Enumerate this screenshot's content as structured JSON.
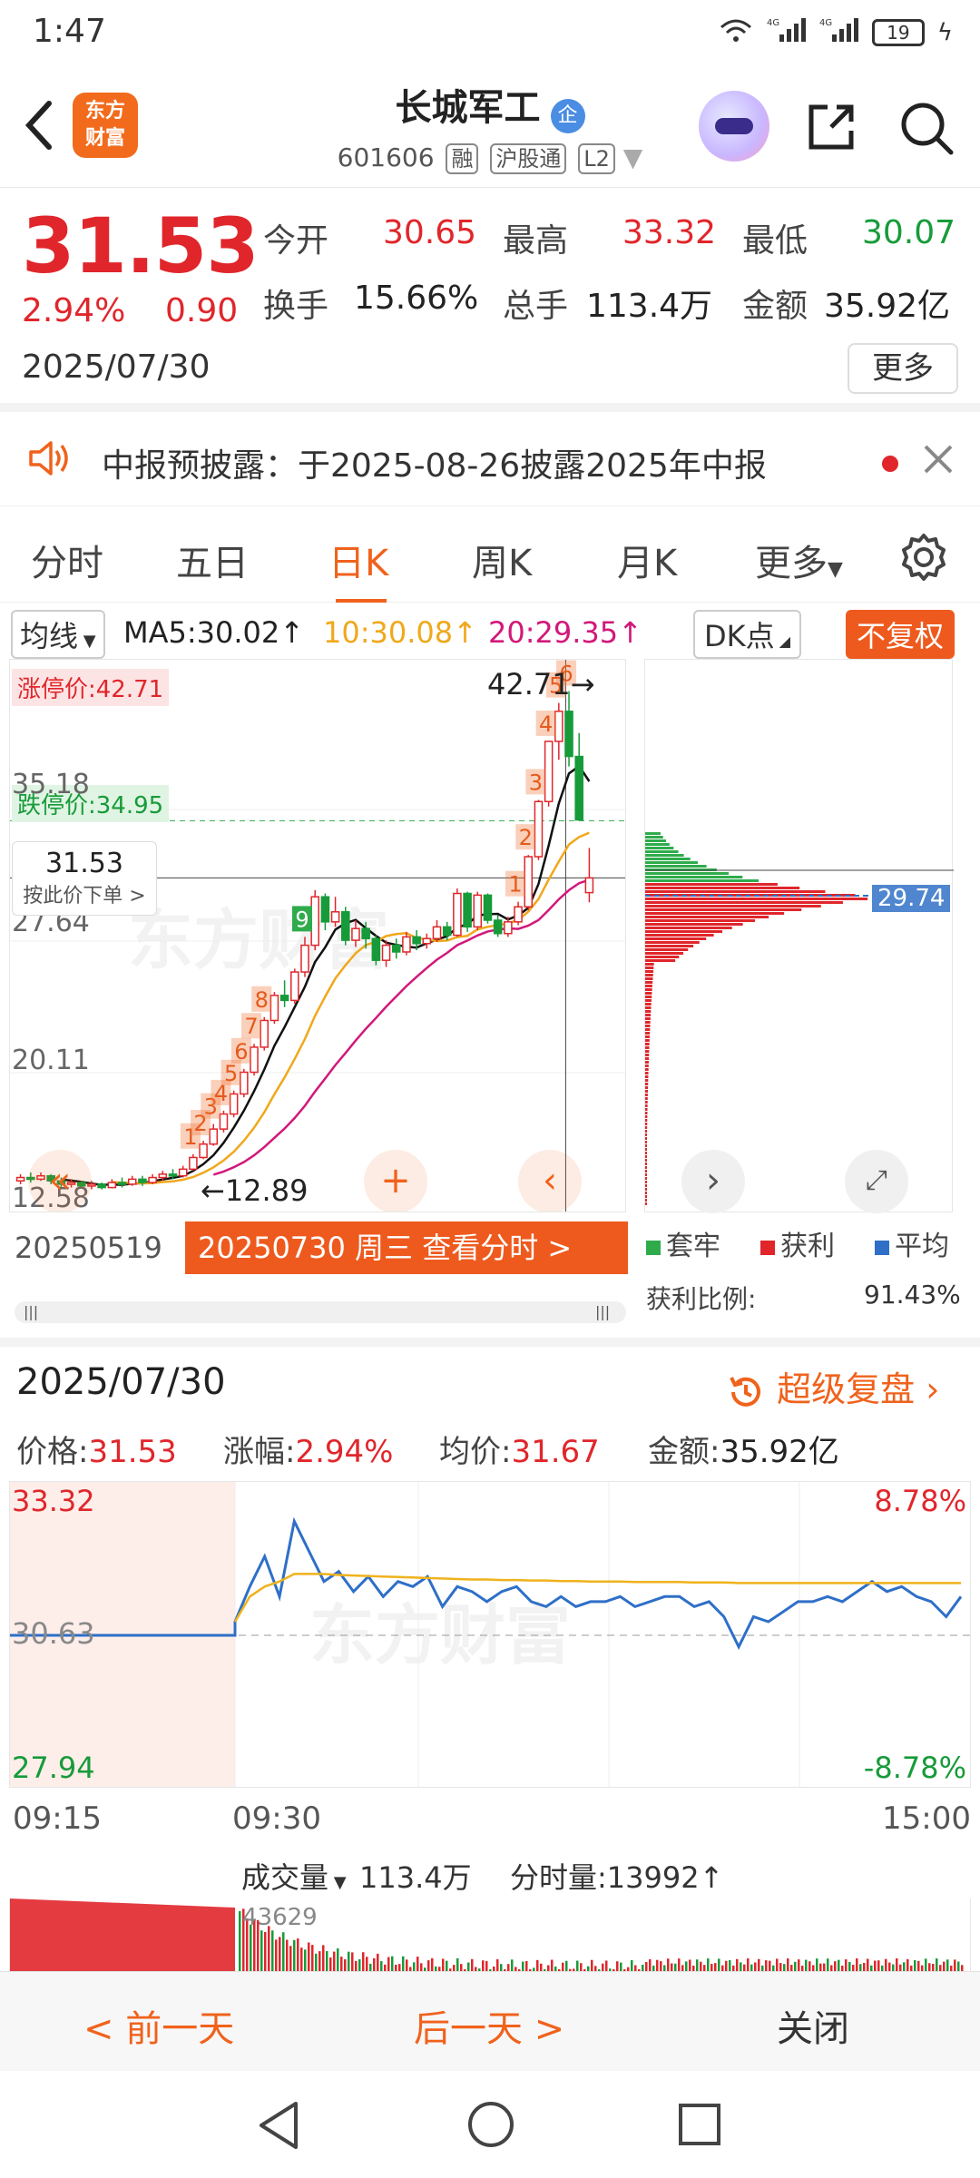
{
  "status": {
    "time": "1:47",
    "battery": "19",
    "net1": "4G",
    "net2": "4G"
  },
  "header": {
    "logo_line1": "东方",
    "logo_line2": "财富",
    "title": "长城军工",
    "title_badge": "企",
    "code": "601606",
    "tags": [
      "融",
      "沪股通",
      "L2"
    ]
  },
  "quote": {
    "price": "31.53",
    "pct": "2.94%",
    "change": "0.90",
    "date": "2025/07/30",
    "open_label": "今开",
    "open": "30.65",
    "high_label": "最高",
    "high": "33.32",
    "low_label": "最低",
    "low": "30.07",
    "turnover_label": "换手",
    "turnover": "15.66%",
    "volume_label": "总手",
    "volume": "113.4万",
    "amount_label": "金额",
    "amount": "35.92亿",
    "more": "更多"
  },
  "notice": {
    "text": "中报预披露：于2025-08-26披露2025年中报"
  },
  "tabs": [
    "分时",
    "五日",
    "日K",
    "周K",
    "月K",
    "更多"
  ],
  "indicator": {
    "ma_select": "均线",
    "ma5": "MA5:30.02↑",
    "ma10": "10:30.08↑",
    "ma20": "20:29.35↑",
    "dk": "DK点",
    "fq": "不复权",
    "ma10_color": "#f0a81c",
    "ma20_color": "#d2187a"
  },
  "kline": {
    "limit_up": "涨停价:42.71",
    "limit_down": "跌停价:34.95",
    "y_labels": [
      "35.18",
      "27.64",
      "20.11",
      "12.58"
    ],
    "high_marker": "42.71",
    "low_marker": "12.89",
    "crosshair_price": "31.53",
    "crosshair_hint": "按此价下单",
    "watermark": "东方财富",
    "counts": [
      "1",
      "2",
      "3",
      "4",
      "5",
      "6",
      "7",
      "8",
      "9",
      "1",
      "2",
      "3",
      "4",
      "5",
      "6"
    ],
    "date_left": "20250519",
    "date_button": "20250730 周三 查看分时 >",
    "candles": [
      {
        "o": 13.4,
        "c": 13.6,
        "h": 13.8,
        "l": 13.2
      },
      {
        "o": 13.6,
        "c": 13.5,
        "h": 13.9,
        "l": 13.3
      },
      {
        "o": 13.5,
        "c": 13.7,
        "h": 13.9,
        "l": 13.4
      },
      {
        "o": 13.7,
        "c": 13.4,
        "h": 13.8,
        "l": 13.2
      },
      {
        "o": 13.4,
        "c": 13.2,
        "h": 13.6,
        "l": 13.0
      },
      {
        "o": 13.2,
        "c": 13.3,
        "h": 13.5,
        "l": 13.0
      },
      {
        "o": 13.3,
        "c": 13.1,
        "h": 13.4,
        "l": 12.95
      },
      {
        "o": 13.1,
        "c": 13.2,
        "h": 13.4,
        "l": 12.9
      },
      {
        "o": 13.2,
        "c": 13.0,
        "h": 13.3,
        "l": 12.89
      },
      {
        "o": 13.0,
        "c": 13.3,
        "h": 13.5,
        "l": 12.95
      },
      {
        "o": 13.3,
        "c": 13.2,
        "h": 13.6,
        "l": 13.0
      },
      {
        "o": 13.2,
        "c": 13.5,
        "h": 13.7,
        "l": 13.1
      },
      {
        "o": 13.5,
        "c": 13.3,
        "h": 13.7,
        "l": 13.1
      },
      {
        "o": 13.3,
        "c": 13.6,
        "h": 13.8,
        "l": 13.2
      },
      {
        "o": 13.6,
        "c": 13.8,
        "h": 14.0,
        "l": 13.4
      },
      {
        "o": 13.8,
        "c": 13.7,
        "h": 14.1,
        "l": 13.5
      },
      {
        "o": 13.7,
        "c": 14.1,
        "h": 14.3,
        "l": 13.6
      },
      {
        "o": 14.1,
        "c": 14.8,
        "h": 15.0,
        "l": 14.0
      },
      {
        "o": 14.8,
        "c": 15.6,
        "h": 15.8,
        "l": 14.7
      },
      {
        "o": 15.6,
        "c": 16.5,
        "h": 16.8,
        "l": 15.5
      },
      {
        "o": 16.5,
        "c": 17.4,
        "h": 17.6,
        "l": 16.3
      },
      {
        "o": 17.4,
        "c": 18.6,
        "h": 18.8,
        "l": 17.2
      },
      {
        "o": 18.6,
        "c": 19.9,
        "h": 20.1,
        "l": 18.4
      },
      {
        "o": 19.9,
        "c": 21.4,
        "h": 21.6,
        "l": 19.7
      },
      {
        "o": 21.4,
        "c": 23.0,
        "h": 23.2,
        "l": 21.2
      },
      {
        "o": 23.0,
        "c": 24.5,
        "h": 24.7,
        "l": 22.8
      },
      {
        "o": 24.5,
        "c": 24.2,
        "h": 25.4,
        "l": 23.8
      },
      {
        "o": 24.2,
        "c": 25.9,
        "h": 26.1,
        "l": 24.0
      },
      {
        "o": 25.9,
        "c": 27.5,
        "h": 28.0,
        "l": 25.6
      },
      {
        "o": 27.5,
        "c": 30.4,
        "h": 30.8,
        "l": 27.2
      },
      {
        "o": 30.4,
        "c": 28.9,
        "h": 30.6,
        "l": 28.4
      },
      {
        "o": 28.9,
        "c": 29.5,
        "h": 30.4,
        "l": 28.6
      },
      {
        "o": 29.5,
        "c": 27.8,
        "h": 29.8,
        "l": 27.5
      },
      {
        "o": 27.8,
        "c": 28.5,
        "h": 29.0,
        "l": 27.4
      },
      {
        "o": 28.5,
        "c": 27.9,
        "h": 28.9,
        "l": 27.3
      },
      {
        "o": 27.9,
        "c": 26.6,
        "h": 28.1,
        "l": 26.3
      },
      {
        "o": 26.6,
        "c": 27.5,
        "h": 27.8,
        "l": 26.2
      },
      {
        "o": 27.5,
        "c": 27.1,
        "h": 27.9,
        "l": 26.7
      },
      {
        "o": 27.1,
        "c": 28.0,
        "h": 28.3,
        "l": 26.9
      },
      {
        "o": 28.0,
        "c": 27.6,
        "h": 28.4,
        "l": 27.2
      },
      {
        "o": 27.6,
        "c": 27.9,
        "h": 28.2,
        "l": 27.3
      },
      {
        "o": 27.9,
        "c": 28.6,
        "h": 29.0,
        "l": 27.7
      },
      {
        "o": 28.6,
        "c": 28.1,
        "h": 28.9,
        "l": 27.8
      },
      {
        "o": 28.1,
        "c": 30.6,
        "h": 30.9,
        "l": 28.0
      },
      {
        "o": 30.6,
        "c": 28.6,
        "h": 30.7,
        "l": 28.3
      },
      {
        "o": 28.6,
        "c": 30.5,
        "h": 30.7,
        "l": 28.4
      },
      {
        "o": 30.5,
        "c": 29.0,
        "h": 30.6,
        "l": 28.8
      },
      {
        "o": 29.0,
        "c": 28.2,
        "h": 29.3,
        "l": 28.0
      },
      {
        "o": 28.2,
        "c": 28.9,
        "h": 29.2,
        "l": 28.0
      },
      {
        "o": 28.9,
        "c": 29.8,
        "h": 30.1,
        "l": 28.7
      },
      {
        "o": 29.8,
        "c": 32.8,
        "h": 32.9,
        "l": 29.6
      },
      {
        "o": 32.8,
        "c": 36.1,
        "h": 36.2,
        "l": 32.6
      },
      {
        "o": 36.1,
        "c": 39.7,
        "h": 39.7,
        "l": 35.8
      },
      {
        "o": 39.7,
        "c": 41.5,
        "h": 42.0,
        "l": 38.6
      },
      {
        "o": 41.5,
        "c": 38.8,
        "h": 42.71,
        "l": 38.2
      },
      {
        "o": 38.8,
        "c": 35.0,
        "h": 40.2,
        "l": 34.95
      },
      {
        "o": 30.65,
        "c": 31.53,
        "h": 33.32,
        "l": 30.07
      }
    ],
    "ylim": [
      12.0,
      43.5
    ]
  },
  "chips": {
    "avg": "29.74",
    "legend": [
      "套牢",
      "获利",
      "平均"
    ],
    "profit_label": "获利比例:",
    "profit_value": "91.43%"
  },
  "detail": {
    "date": "2025/07/30",
    "replay": "超级复盘",
    "price_label": "价格:",
    "price": "31.53",
    "pct_label": "涨幅:",
    "pct": "2.94%",
    "avg_label": "均价:",
    "avg": "31.67",
    "amount_label": "金额:",
    "amount": "35.92亿"
  },
  "intraday": {
    "top": "33.32",
    "mid": "30.63",
    "bottom": "27.94",
    "top_pct": "8.78%",
    "bottom_pct": "-8.78%",
    "t_start": "09:15",
    "t_open": "09:30",
    "t_end": "15:00",
    "watermark": "东方财富",
    "price_series": [
      30.63,
      30.63,
      30.63,
      30.63,
      30.63,
      30.9,
      31.6,
      32.2,
      31.4,
      32.9,
      32.3,
      31.7,
      31.9,
      31.5,
      31.8,
      31.4,
      31.7,
      31.6,
      31.8,
      31.2,
      31.6,
      31.5,
      31.3,
      31.5,
      31.6,
      31.3,
      31.2,
      31.4,
      31.2,
      31.3,
      31.3,
      31.4,
      31.2,
      31.3,
      31.4,
      31.4,
      31.2,
      31.3,
      31.0,
      30.4,
      31.0,
      30.9,
      31.1,
      31.3,
      31.3,
      31.4,
      31.3,
      31.5,
      31.7,
      31.5,
      31.6,
      31.4,
      31.3,
      31.0,
      31.4
    ],
    "avg_series": [
      null,
      null,
      null,
      null,
      null,
      30.9,
      31.4,
      31.6,
      31.7,
      31.85,
      31.85,
      31.85,
      31.83,
      31.82,
      31.81,
      31.8,
      31.79,
      31.78,
      31.77,
      31.76,
      31.75,
      31.74,
      31.74,
      31.73,
      31.73,
      31.72,
      31.72,
      31.71,
      31.71,
      31.7,
      31.7,
      31.7,
      31.69,
      31.69,
      31.69,
      31.69,
      31.68,
      31.68,
      31.68,
      31.67,
      31.67,
      31.67,
      31.67,
      31.67,
      31.67,
      31.67,
      31.67,
      31.67,
      31.67,
      31.67,
      31.67,
      31.67,
      31.67,
      31.67,
      31.67
    ]
  },
  "volume": {
    "label": "成交量",
    "total": "113.4万",
    "tick_label": "分时量:13992↑",
    "peak": "43629"
  },
  "bottom": {
    "prev": "< 前一天",
    "next": "后一天 >",
    "close": "关闭"
  }
}
